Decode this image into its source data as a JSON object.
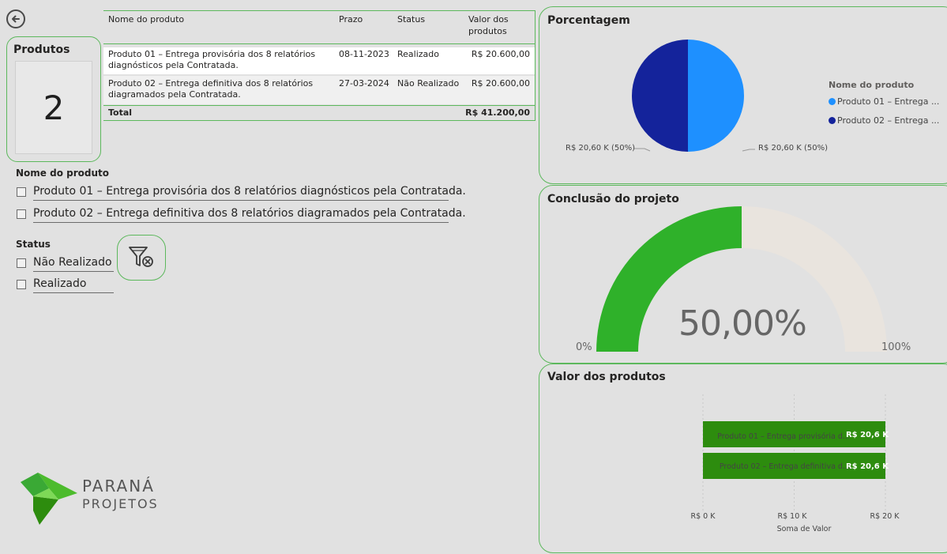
{
  "table": {
    "headers": [
      "Nome do produto",
      "Prazo",
      "Status",
      "Valor dos produtos"
    ],
    "rows": [
      {
        "product": "Produto 01 – Entrega provisória dos 8 relatórios diagnósticos pela Contratada.",
        "deadline": "08-11-2023",
        "status": "Realizado",
        "value": "R$ 20.600,00"
      },
      {
        "product": "Produto 02 – Entrega definitiva dos 8 relatórios diagramados pela Contratada.",
        "deadline": "27-03-2024",
        "status": "Não Realizado",
        "value": "R$ 20.600,00"
      }
    ],
    "total_label": "Total",
    "total_value": "R$ 41.200,00"
  },
  "card": {
    "title": "Produtos",
    "value": "2"
  },
  "slicer_product": {
    "title": "Nome do produto",
    "items": [
      "Produto 01 – Entrega provisória dos 8 relatórios diagnósticos pela Contratada.",
      "Produto 02 – Entrega definitiva dos 8 relatórios diagramados pela Contratada."
    ]
  },
  "slicer_status": {
    "title": "Status",
    "items": [
      "Não Realizado",
      "Realizado"
    ]
  },
  "logo": {
    "line1": "PARANÁ",
    "line2": "PROJETOS"
  },
  "colors": {
    "accent_green": "#5cb85c",
    "bar_green": "#2d8c0e",
    "gauge_green": "#2fb12a",
    "gauge_rest": "#e9e4de",
    "pie_1": "#1e90ff",
    "pie_2": "#14239b"
  },
  "pie": {
    "title": "Porcentagem",
    "legend_title": "Nome do produto",
    "legend": [
      "Produto 01 – Entrega ...",
      "Produto 02 – Entrega ..."
    ],
    "label_left": "R$ 20,60 K (50%)",
    "label_right": "R$ 20,60 K (50%)"
  },
  "gauge": {
    "title": "Conclusão do projeto",
    "value_text": "50,00%",
    "min_label": "0%",
    "max_label": "100%",
    "fraction": 0.5
  },
  "bars": {
    "title": "Valor dos produtos",
    "x_axis_title": "Soma de Valor",
    "ticks": [
      "R$ 0 K",
      "R$ 10 K",
      "R$ 20 K"
    ],
    "labels": [
      "Produto 01 – Entrega provisória d...",
      "Produto 02 – Entrega definitiva d..."
    ],
    "data_labels": [
      "R$ 20,6 K",
      "R$ 20,6 K"
    ]
  },
  "chart_data": [
    {
      "type": "pie",
      "title": "Porcentagem",
      "categories": [
        "Produto 01 – Entrega ...",
        "Produto 02 – Entrega ..."
      ],
      "values": [
        20.6,
        20.6
      ]
    },
    {
      "type": "bar",
      "title": "Valor dos produtos",
      "categories": [
        "Produto 01 – Entrega provisória d...",
        "Produto 02 – Entrega definitiva d..."
      ],
      "values": [
        20.6,
        20.6
      ],
      "xlabel": "Soma de Valor",
      "xlim": [
        0,
        20
      ]
    }
  ]
}
